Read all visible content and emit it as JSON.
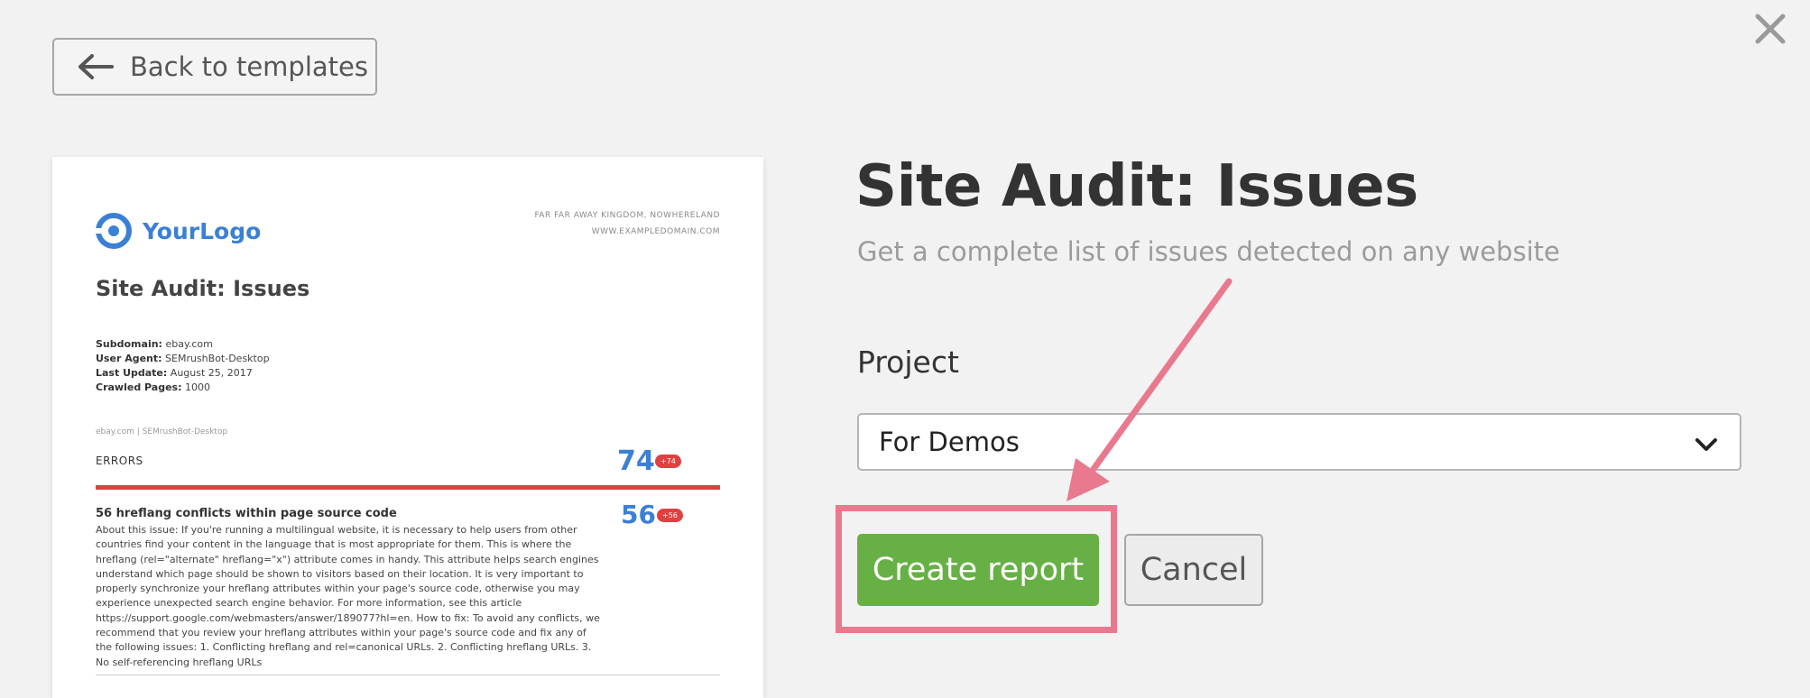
{
  "header": {
    "back_label": "Back to templates",
    "close_icon": "close-icon"
  },
  "preview": {
    "logo_text": "YourLogo",
    "address_line1": "FAR FAR AWAY KINGDOM, NOWHERELAND",
    "address_line2": "WWW.EXAMPLEDOMAIN.COM",
    "title": "Site Audit: Issues",
    "meta": [
      {
        "label": "Subdomain:",
        "value": "ebay.com"
      },
      {
        "label": "User Agent:",
        "value": "SEMrushBot-Desktop"
      },
      {
        "label": "Last Update:",
        "value": "August 25, 2017"
      },
      {
        "label": "Crawled Pages:",
        "value": "1000"
      }
    ],
    "source_line": "ebay.com | SEMrushBot-Desktop",
    "errors_label": "ERRORS",
    "errors_count": "74",
    "errors_badge": "+74",
    "issue_title": "56 hreflang conflicts within page source code",
    "issue_count": "56",
    "issue_badge": "+56",
    "issue_body": "About this issue: If you're running a multilingual website, it is necessary to help users from other countries find your content in the language that is most appropriate for them. This is where the hreflang (rel=\"alternate\" hreflang=\"x\") attribute comes in handy. This attribute helps search engines understand which page should be shown to visitors based on their location. It is very important to properly synchronize your hreflang attributes within your page's source code, otherwise you may experience unexpected search engine behavior. For more information, see this article https://support.google.com/webmasters/answer/189077?hl=en. How to fix: To avoid any conflicts, we recommend that you review your hreflang attributes within your page's source code and fix any of the following issues: 1. Conflicting hreflang and rel=canonical URLs. 2. Conflicting hreflang URLs. 3. No self-referencing hreflang URLs"
  },
  "main": {
    "title": "Site Audit: Issues",
    "subtitle": "Get a complete list of issues detected on any website",
    "project_label": "Project",
    "project_selected": "For Demos",
    "create_label": "Create report",
    "cancel_label": "Cancel"
  },
  "colors": {
    "accent_green": "#67b045",
    "highlight_pink": "#e9798e",
    "logo_blue": "#3b7fd6",
    "error_red": "#e0403f"
  }
}
